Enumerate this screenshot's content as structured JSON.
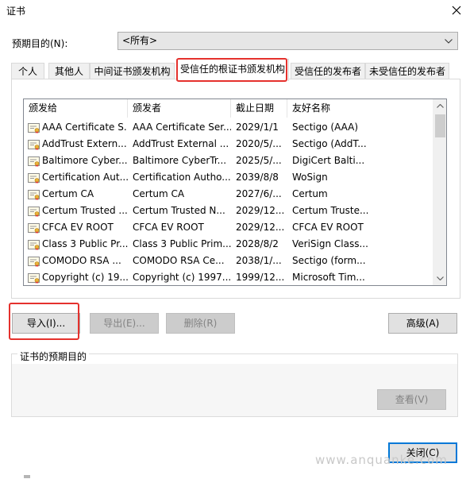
{
  "window": {
    "title": "证书",
    "close_icon": "close-icon"
  },
  "purpose": {
    "label": "预期目的(N):",
    "selected": "<所有>"
  },
  "tabs": [
    {
      "label": "个人",
      "active": false
    },
    {
      "label": "其他人",
      "active": false
    },
    {
      "label": "中间证书颁发机构",
      "active": false
    },
    {
      "label": "受信任的根证书颁发机构",
      "active": true
    },
    {
      "label": "受信任的发布者",
      "active": false
    },
    {
      "label": "未受信任的发布者",
      "active": false
    }
  ],
  "table": {
    "columns": [
      "颁发给",
      "颁发者",
      "截止日期",
      "友好名称"
    ],
    "rows": [
      [
        "AAA Certificate S...",
        "AAA Certificate Ser...",
        "2029/1/1",
        "Sectigo (AAA)"
      ],
      [
        "AddTrust Extern...",
        "AddTrust External ...",
        "2020/5/...",
        "Sectigo (AddT..."
      ],
      [
        "Baltimore Cyber...",
        "Baltimore CyberTr...",
        "2025/5/...",
        "DigiCert Balti..."
      ],
      [
        "Certification Aut...",
        "Certification Autho...",
        "2039/8/8",
        "WoSign"
      ],
      [
        "Certum CA",
        "Certum CA",
        "2027/6/...",
        "Certum"
      ],
      [
        "Certum Trusted ...",
        "Certum Trusted N...",
        "2029/12...",
        "Certum Truste..."
      ],
      [
        "CFCA EV ROOT",
        "CFCA EV ROOT",
        "2029/12...",
        "CFCA EV ROOT"
      ],
      [
        "Class 3 Public Pr...",
        "Class 3 Public Prim...",
        "2028/8/2",
        "VeriSign Class..."
      ],
      [
        "COMODO RSA ...",
        "COMODO RSA Ce...",
        "2038/1/...",
        "Sectigo (form..."
      ],
      [
        "Copyright (c) 19...",
        "Copyright (c) 1997...",
        "1999/12...",
        "Microsoft Tim..."
      ]
    ]
  },
  "buttons": {
    "import": "导入(I)...",
    "export": "导出(E)...",
    "remove": "删除(R)",
    "advanced": "高级(A)",
    "view": "查看(V)",
    "close": "关闭(C)"
  },
  "group": {
    "label": "证书的预期目的"
  },
  "watermark": "www.anquanke.com",
  "colors": {
    "highlight": "#e5312d",
    "default_button_border": "#0078d7"
  }
}
